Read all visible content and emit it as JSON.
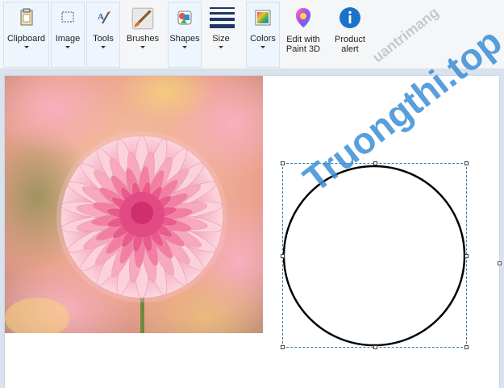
{
  "ribbon": {
    "clipboard_label": "Clipboard",
    "image_label": "Image",
    "tools_label": "Tools",
    "brushes_label": "Brushes",
    "shapes_label": "Shapes",
    "size_label": "Size",
    "colors_label": "Colors",
    "edit_paint3d_label_1": "Edit with",
    "edit_paint3d_label_2": "Paint 3D",
    "product_alert_label_1": "Product",
    "product_alert_label_2": "alert"
  },
  "watermark": {
    "main": "Truongthi.top",
    "secondary": "uantrimang"
  },
  "colors": {
    "ribbon_bg": "#f5f6f7",
    "workspace_bg": "#d9e3ef",
    "selection_border": "#3a79a8",
    "watermark_blue": "#3b8fd6",
    "watermark_orange": "#f07a28",
    "info_blue": "#1a73c9"
  }
}
